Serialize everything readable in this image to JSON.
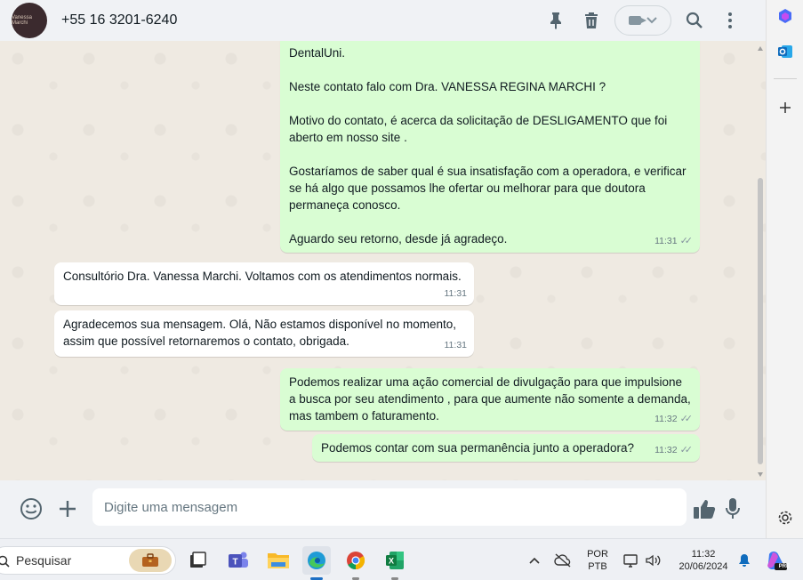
{
  "header": {
    "contact_name": "+55 16 3201-6240",
    "avatar_text": "Vanessa Marchi"
  },
  "messages": [
    {
      "direction": "out",
      "text": "DentalUni.\n\nNeste contato falo com Dra. VANESSA REGINA MARCHI ?\n\nMotivo do contato, é acerca da solicitação de DESLIGAMENTO que foi aberto em nosso site .\n\nGostaríamos de saber qual é sua insatisfação com a operadora, e verificar se há algo que possamos lhe ofertar ou melhorar para que doutora permaneça conosco.\n\nAguardo seu retorno, desde já agradeço.",
      "time": "11:31",
      "status": "delivered"
    },
    {
      "direction": "in",
      "text": "Consultório Dra. Vanessa Marchi. Voltamos com os atendimentos normais.",
      "time": "11:31"
    },
    {
      "direction": "in",
      "text": "Agradecemos sua mensagem. Olá, Não estamos disponível no momento, assim que possível retornaremos o contato, obrigada.",
      "time": "11:31"
    },
    {
      "direction": "out",
      "text": "Podemos realizar uma ação comercial de divulgação para que impulsione a busca por seu atendimento , para que aumente não somente a demanda, mas tambem o faturamento.",
      "time": "11:32",
      "status": "delivered"
    },
    {
      "direction": "out",
      "text": "Podemos contar com sua permanência junto a operadora?",
      "time": "11:32",
      "status": "delivered"
    }
  ],
  "composer": {
    "placeholder": "Digite uma mensagem"
  },
  "taskbar": {
    "search_label": "Pesquisar",
    "lang_top": "POR",
    "lang_bottom": "PTB",
    "time": "11:32",
    "date": "20/06/2024",
    "copilot_badge": "PRE"
  },
  "colors": {
    "outgoing_bubble": "#d9fdd3",
    "incoming_bubble": "#ffffff",
    "chat_background": "#efeae2",
    "header_background": "#f0f2f5"
  },
  "icons": {
    "header": [
      "pin-icon",
      "delete-icon",
      "video-call-icon",
      "search-icon",
      "menu-icon"
    ],
    "composer": [
      "emoji-icon",
      "attach-icon",
      "thumbs-up-icon",
      "mic-icon"
    ]
  }
}
